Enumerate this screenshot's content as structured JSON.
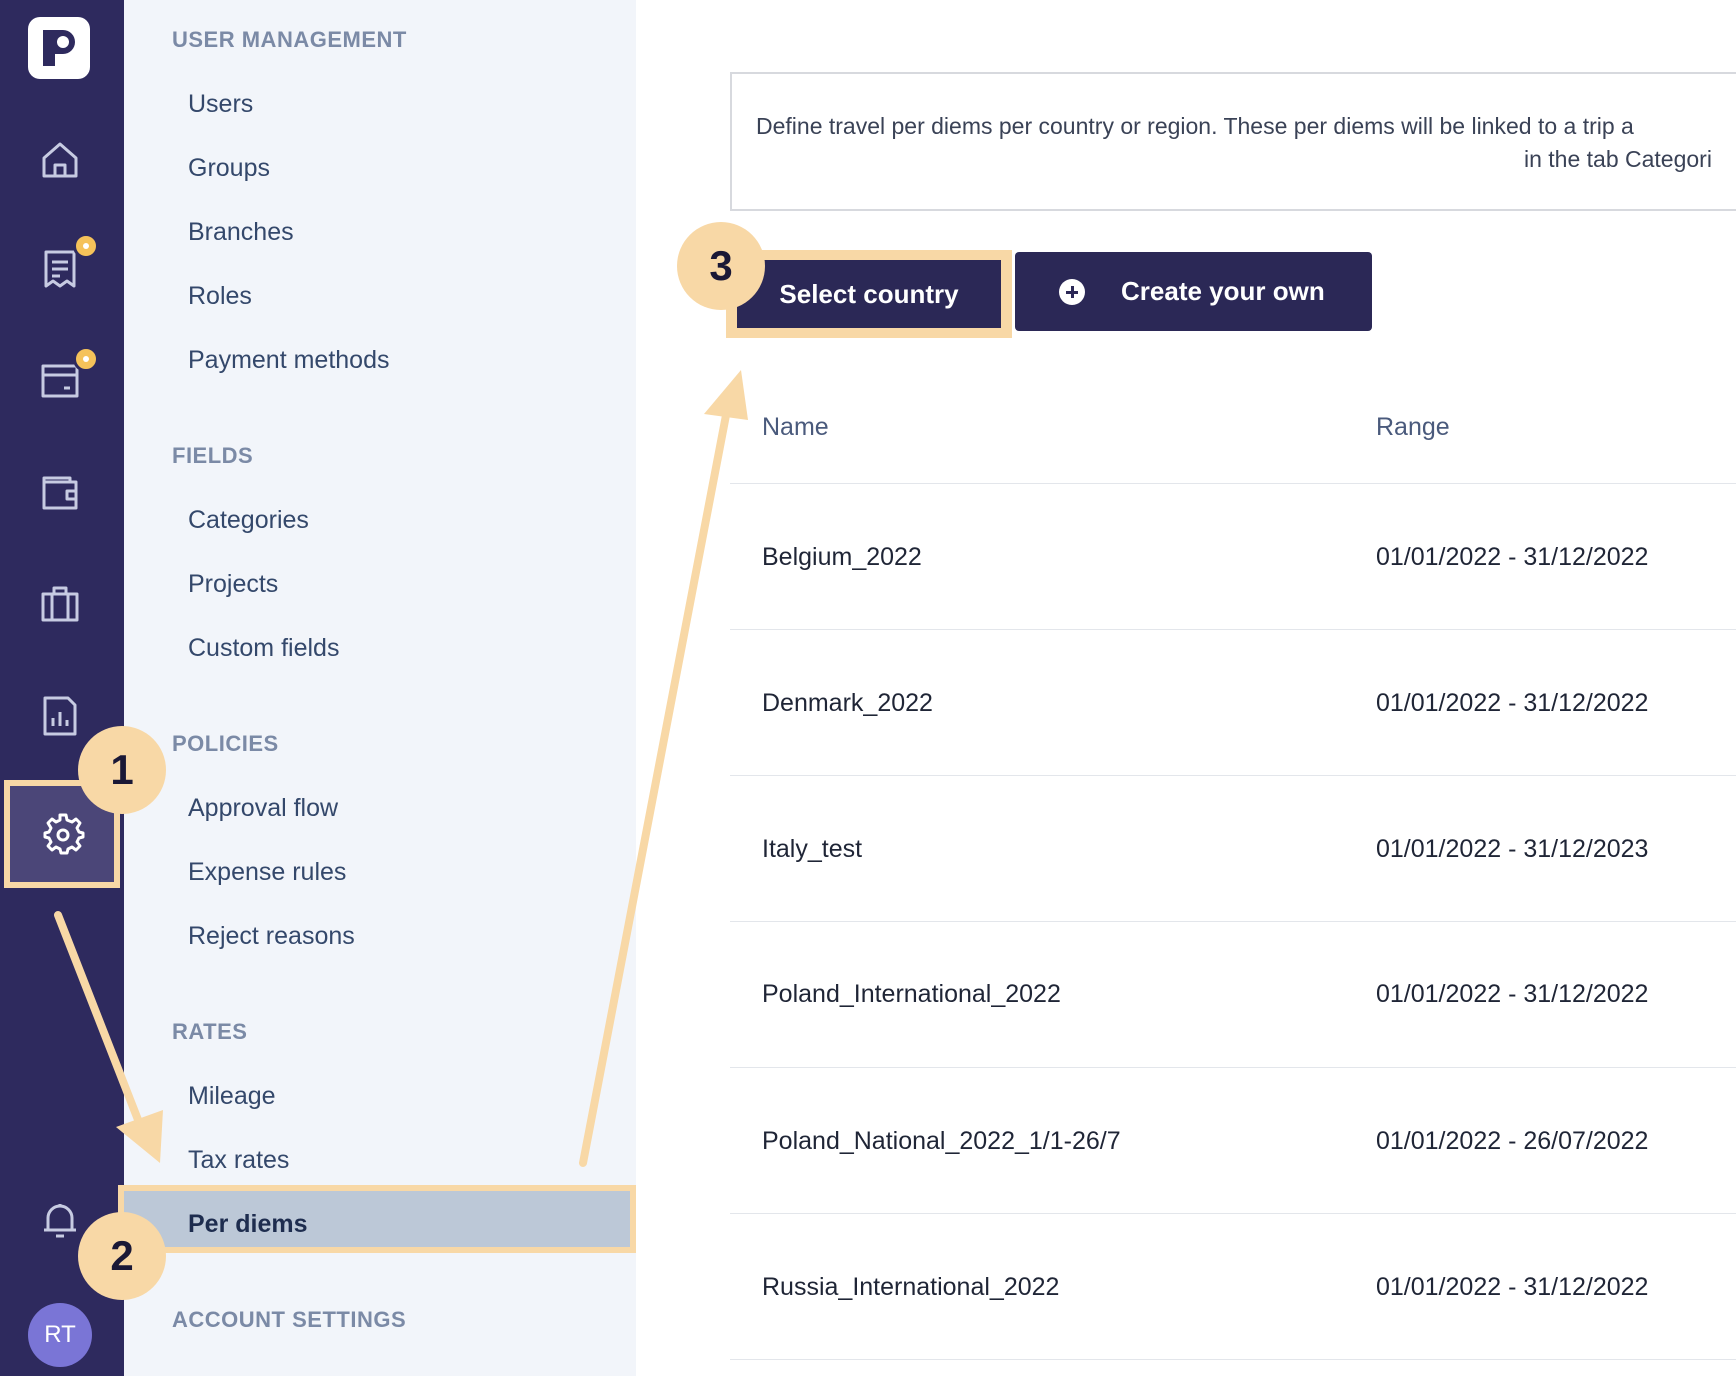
{
  "rail": {
    "avatar_initials": "RT",
    "icons": [
      "logo-icon",
      "home-icon",
      "receipt-icon",
      "card-icon",
      "wallet-icon",
      "suitcase-icon",
      "report-icon",
      "settings-icon",
      "bell-icon"
    ],
    "badge_color": "#f5c25a"
  },
  "sidebar": {
    "user_management": {
      "title": "USER MANAGEMENT",
      "items": [
        "Users",
        "Groups",
        "Branches",
        "Roles",
        "Payment methods"
      ]
    },
    "fields": {
      "title": "FIELDS",
      "items": [
        "Categories",
        "Projects",
        "Custom fields"
      ]
    },
    "policies": {
      "title": "POLICIES",
      "items": [
        "Approval flow",
        "Expense rules",
        "Reject reasons"
      ]
    },
    "rates": {
      "title": "RATES",
      "items": [
        "Mileage",
        "Tax rates",
        "Per diems"
      ]
    },
    "account_settings": {
      "title": "ACCOUNT SETTINGS"
    }
  },
  "main": {
    "info_line1": "Define travel per diems per country or region. These per diems will be linked to a trip a",
    "info_line2": "in the tab Categori",
    "select_country_label": "Select country",
    "create_own_label": "Create your own",
    "table": {
      "headers": [
        "Name",
        "Range"
      ],
      "rows": [
        {
          "name": "Belgium_2022",
          "range": "01/01/2022 - 31/12/2022"
        },
        {
          "name": "Denmark_2022",
          "range": "01/01/2022 - 31/12/2022"
        },
        {
          "name": "Italy_test",
          "range": "01/01/2022 - 31/12/2023"
        },
        {
          "name": "Poland_International_2022",
          "range": "01/01/2022 - 31/12/2022"
        },
        {
          "name": "Poland_National_2022_1/1-26/7",
          "range": "01/01/2022 - 26/07/2022"
        },
        {
          "name": "Russia_International_2022",
          "range": "01/01/2022 - 31/12/2022"
        }
      ]
    }
  },
  "callouts": [
    "1",
    "2",
    "3"
  ],
  "colors": {
    "rail_bg": "#2e2a5e",
    "highlight": "#f8d8a6",
    "button_bg": "#2b2856",
    "sidebar_bg": "#f2f5fa"
  }
}
